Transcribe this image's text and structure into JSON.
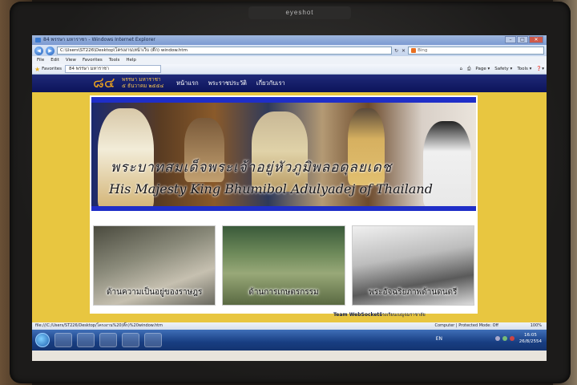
{
  "monitor": {
    "brand": "eyeshot"
  },
  "browser": {
    "title": "84 พรรษา มหาราชา - Windows Internet Explorer",
    "address": "C:\\Users\\ST226\\Desktop\\โครงงาน\\หน้าเว็บ (ติ๊ก) window.htm",
    "search_engine": "Bing",
    "menu": [
      "File",
      "Edit",
      "View",
      "Favorites",
      "Tools",
      "Help"
    ],
    "favorites_label": "Favorites",
    "tab_label": "84 พรรษา มหาราชา",
    "commands": [
      "Page ▾",
      "Safety ▾",
      "Tools ▾",
      "❓▾"
    ],
    "status_url": "file:///C:/Users/ST226/Desktop/โครงงาน%20(ติ๊ก)%20window.htm",
    "status_zone": "Computer | Protected Mode: Off",
    "zoom": "100%"
  },
  "site": {
    "logo_number": "๘๔",
    "logo_line1": "พรรษา มหาราชา",
    "logo_line2": "๕ ธันวาคม ๒๕๕๔",
    "nav": [
      "หน้าแรก",
      "พระราชประวัติ",
      "เกี่ยวกับเรา"
    ],
    "hero_title_th": "พระบาทสมเด็จพระเจ้าอยู่หัวภูมิพลอดุลยเดช",
    "hero_title_en": "His Majesty King Bhumibol Adulyadej of Thailand",
    "cards": [
      {
        "label": "ด้านความเป็นอยู่ของราษฎร"
      },
      {
        "label": "ด้านการเกษตรกรรม"
      },
      {
        "label": "พระอัจฉริยภาพด้านดนตรี"
      }
    ],
    "footer_team": "Team WebSockets",
    "footer_school": "โรงเรียนเบญจมราชาลัย"
  },
  "taskbar": {
    "language": "EN",
    "time": "16:05",
    "date": "26/8/2554"
  }
}
